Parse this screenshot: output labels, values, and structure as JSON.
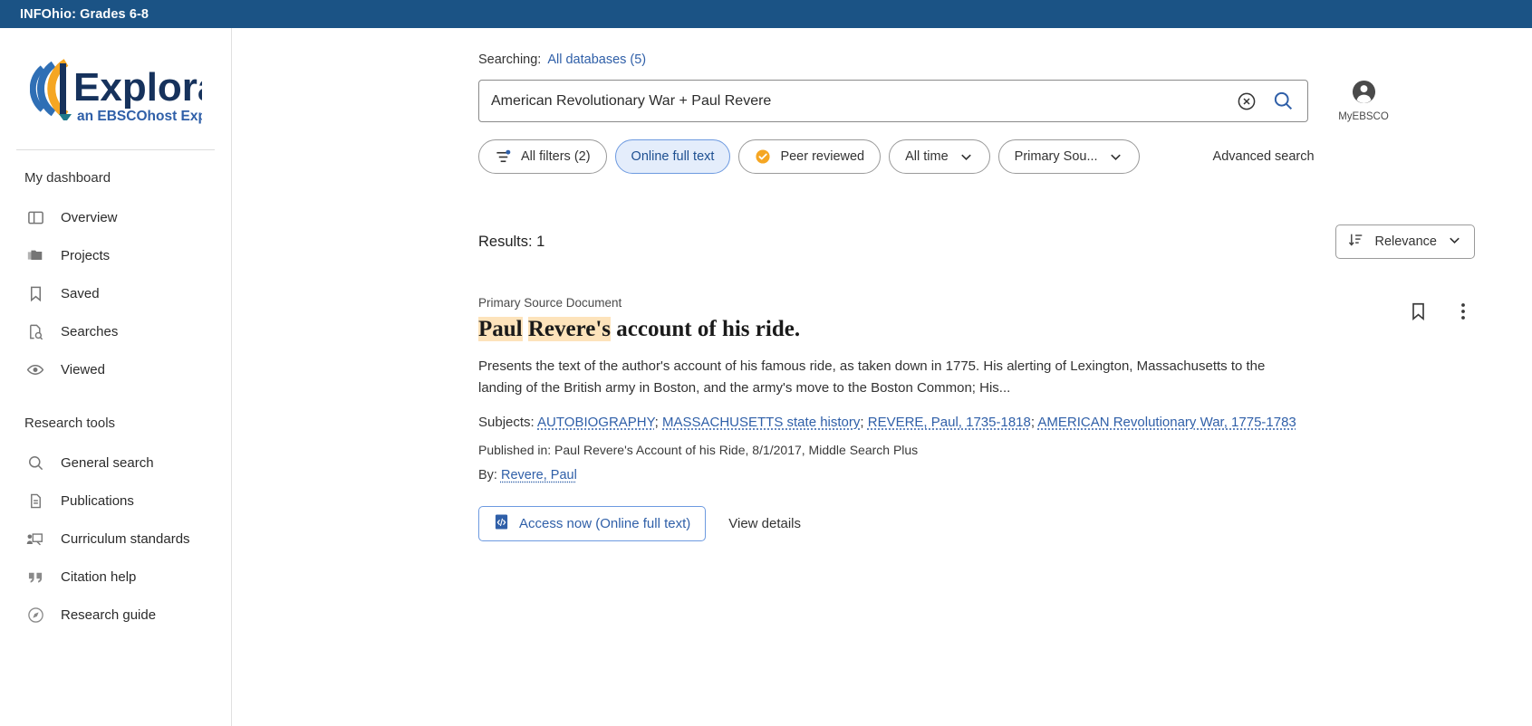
{
  "topbar": {
    "title": "INFOhio: Grades 6-8"
  },
  "branding": {
    "logo_name": "Explora",
    "logo_tagline": "an EBSCOhost Experience",
    "logo_colors": {
      "navy": "#16325c",
      "blue": "#2f5fa8",
      "orange": "#f5a623",
      "teal": "#1f7a8c"
    }
  },
  "sidebar": {
    "dashboard_heading": "My dashboard",
    "dashboard_items": [
      {
        "label": "Overview",
        "icon": "layout-panel-icon"
      },
      {
        "label": "Projects",
        "icon": "folders-icon"
      },
      {
        "label": "Saved",
        "icon": "bookmark-icon"
      },
      {
        "label": "Searches",
        "icon": "document-search-icon"
      },
      {
        "label": "Viewed",
        "icon": "eye-icon"
      }
    ],
    "tools_heading": "Research tools",
    "tools_items": [
      {
        "label": "General search",
        "icon": "search-icon"
      },
      {
        "label": "Publications",
        "icon": "document-icon"
      },
      {
        "label": "Curriculum standards",
        "icon": "presentation-icon"
      },
      {
        "label": "Citation help",
        "icon": "quote-icon"
      },
      {
        "label": "Research guide",
        "icon": "compass-icon"
      }
    ]
  },
  "search": {
    "searching_label": "Searching:",
    "database_link": "All databases (5)",
    "query": "American Revolutionary War + Paul Revere",
    "placeholder": "Search",
    "clear_icon": "clear-circle-icon",
    "submit_icon": "search-icon",
    "account_label": "MyEBSCO",
    "account_icon": "user-avatar-icon"
  },
  "filters": {
    "all_filters": {
      "label": "All filters (2)",
      "icon": "filter-sliders-icon",
      "active": false
    },
    "chips": [
      {
        "label": "Online full text",
        "active": true,
        "icon": null
      },
      {
        "label": "Peer reviewed",
        "active": false,
        "icon": "verified-badge-icon"
      },
      {
        "label": "All time",
        "active": false,
        "icon": null,
        "caret": true
      },
      {
        "label": "Primary Sou...",
        "active": false,
        "icon": null,
        "caret": true
      }
    ],
    "advanced_search": "Advanced search"
  },
  "results": {
    "count_label": "Results: 1",
    "sort": {
      "label": "Relevance",
      "icon": "sort-descending-icon"
    },
    "items": [
      {
        "doc_type": "Primary Source Document",
        "title_highlight_1": "Paul",
        "title_highlight_2": "Revere's",
        "title_rest": " account of his ride.",
        "abstract": "Presents the text of the author's account of his famous ride, as taken down in 1775. His alerting of Lexington, Massachusetts to the landing of the British army in Boston, and the army's move to the Boston Common; His...",
        "subjects_label": "Subjects:",
        "subjects": [
          "AUTOBIOGRAPHY",
          "MASSACHUSETTS state history",
          "REVERE, Paul, 1735-1818",
          "AMERICAN Revolutionary War, 1775-1783"
        ],
        "published_in": "Published in: Paul Revere's Account of his Ride, 8/1/2017, Middle Search Plus",
        "by_label": "By:",
        "by_author": "Revere, Paul",
        "access_button": "Access now (Online full text)",
        "access_icon": "article-document-icon",
        "view_details": "View details",
        "save_icon": "bookmark-icon",
        "more_icon": "kebab-menu-icon"
      }
    ]
  }
}
